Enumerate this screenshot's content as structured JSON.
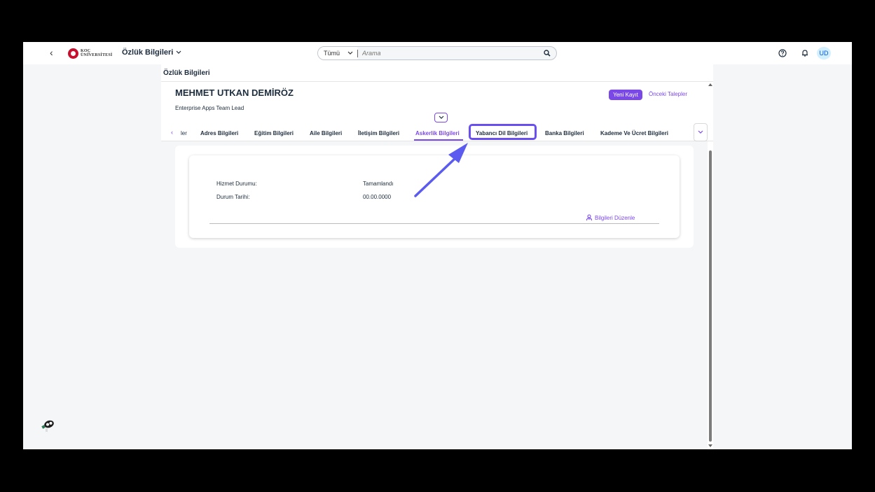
{
  "shell": {
    "brand": "KOÇ ÜNİVERSİTESİ",
    "brand_line1": "KOÇ",
    "brand_line2": "ÜNİVERSİTESİ",
    "app_title": "Özlük Bilgileri",
    "search_scope": "Tümü",
    "search_placeholder": "Arama",
    "avatar_initials": "UD"
  },
  "page": {
    "title": "Özlük Bilgileri",
    "employee_name": "MEHMET UTKAN DEMİRÖZ",
    "employee_role": "Enterprise Apps Team Lead",
    "new_record_label": "Yeni Kayıt",
    "previous_requests_label": "Önceki Talepler"
  },
  "tabs": {
    "partial_label": "ler",
    "items": [
      {
        "label": "Adres Bilgileri"
      },
      {
        "label": "Eğitim Bilgileri"
      },
      {
        "label": "Aile Bilgileri"
      },
      {
        "label": "İletişim Bilgileri"
      },
      {
        "label": "Askerlik Bilgileri",
        "active": true
      },
      {
        "label": "Yabancı Dil Bilgileri",
        "highlighted": true
      },
      {
        "label": "Banka Bilgileri"
      },
      {
        "label": "Kademe Ve Ücret Bilgileri"
      }
    ]
  },
  "military": {
    "fields": [
      {
        "label": "Hizmet Durumu:",
        "value": "Tamamlandı"
      },
      {
        "label": "Durum Tarihi:",
        "value": "00.00.0000"
      }
    ],
    "edit_label": "Bilgileri Düzenle"
  },
  "colors": {
    "accent": "#7b48e8",
    "highlight": "#6a4ff0"
  }
}
